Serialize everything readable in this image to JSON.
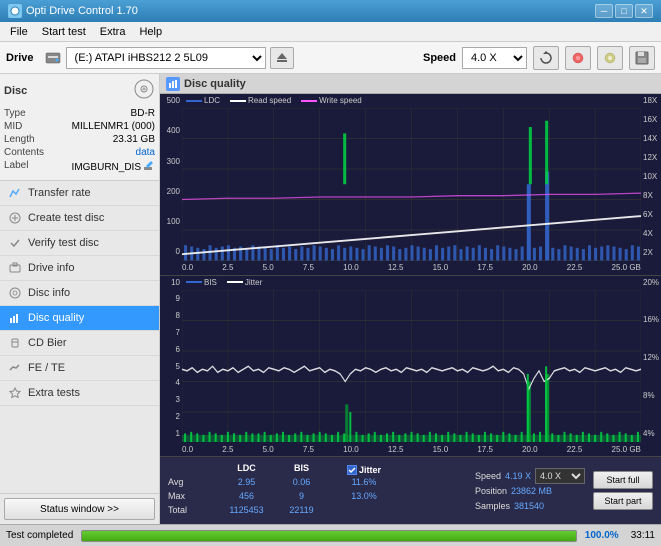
{
  "titlebar": {
    "title": "Opti Drive Control 1.70",
    "icon": "●",
    "min_btn": "─",
    "max_btn": "□",
    "close_btn": "✕"
  },
  "menubar": {
    "items": [
      "File",
      "Start test",
      "Extra",
      "Help"
    ]
  },
  "toolbar": {
    "drive_label": "Drive",
    "drive_value": "(E:) ATAPI iHBS212  2 5L09",
    "speed_label": "Speed",
    "speed_value": "4.0 X"
  },
  "sidebar": {
    "disc_title": "Disc",
    "disc_type_label": "Type",
    "disc_type_value": "BD-R",
    "disc_mid_label": "MID",
    "disc_mid_value": "MILLENMR1 (000)",
    "disc_length_label": "Length",
    "disc_length_value": "23.31 GB",
    "disc_contents_label": "Contents",
    "disc_contents_value": "data",
    "disc_label_label": "Label",
    "disc_label_value": "IMGBURN_DIS",
    "nav_items": [
      {
        "id": "transfer-rate",
        "label": "Transfer rate",
        "icon": "📈"
      },
      {
        "id": "create-test-disc",
        "label": "Create test disc",
        "icon": "💿"
      },
      {
        "id": "verify-test-disc",
        "label": "Verify test disc",
        "icon": "✔"
      },
      {
        "id": "drive-info",
        "label": "Drive info",
        "icon": "ℹ"
      },
      {
        "id": "disc-info",
        "label": "Disc info",
        "icon": "ℹ"
      },
      {
        "id": "disc-quality",
        "label": "Disc quality",
        "icon": "📊",
        "active": true
      },
      {
        "id": "cd-bier",
        "label": "CD Bier",
        "icon": "🍺"
      },
      {
        "id": "fe-te",
        "label": "FE / TE",
        "icon": "📉"
      },
      {
        "id": "extra-tests",
        "label": "Extra tests",
        "icon": "🔬"
      }
    ],
    "status_btn": "Status window >>"
  },
  "chart": {
    "title": "Disc quality",
    "top_legend": {
      "ldc": "LDC",
      "read_speed": "Read speed",
      "write_speed": "Write speed"
    },
    "top_y_left": [
      "500",
      "400",
      "300",
      "200",
      "100",
      "0"
    ],
    "top_y_right": [
      "18X",
      "16X",
      "14X",
      "12X",
      "10X",
      "8X",
      "6X",
      "4X",
      "2X"
    ],
    "bottom_legend": {
      "bis": "BIS",
      "jitter": "Jitter"
    },
    "bottom_y_left": [
      "10",
      "9",
      "8",
      "7",
      "6",
      "5",
      "4",
      "3",
      "2",
      "1"
    ],
    "bottom_y_right": [
      "20%",
      "16%",
      "12%",
      "8%",
      "4%"
    ],
    "x_labels": [
      "0.0",
      "2.5",
      "5.0",
      "7.5",
      "10.0",
      "12.5",
      "15.0",
      "17.5",
      "20.0",
      "22.5",
      "25.0 GB"
    ]
  },
  "stats": {
    "ldc_label": "LDC",
    "bis_label": "BIS",
    "jitter_label": "Jitter",
    "speed_label": "Speed",
    "avg_label": "Avg",
    "avg_ldc": "2.95",
    "avg_bis": "0.06",
    "avg_jitter": "11.6%",
    "max_label": "Max",
    "max_ldc": "456",
    "max_bis": "9",
    "max_jitter": "13.0%",
    "total_label": "Total",
    "total_ldc": "1125453",
    "total_bis": "22119",
    "speed_value": "4.19 X",
    "speed_target": "4.0 X",
    "position_label": "Position",
    "position_value": "23862 MB",
    "samples_label": "Samples",
    "samples_value": "381540",
    "start_full_label": "Start full",
    "start_part_label": "Start part"
  },
  "statusbar": {
    "status_text": "Test completed",
    "progress_percent": "100.0%",
    "time": "33:11"
  }
}
